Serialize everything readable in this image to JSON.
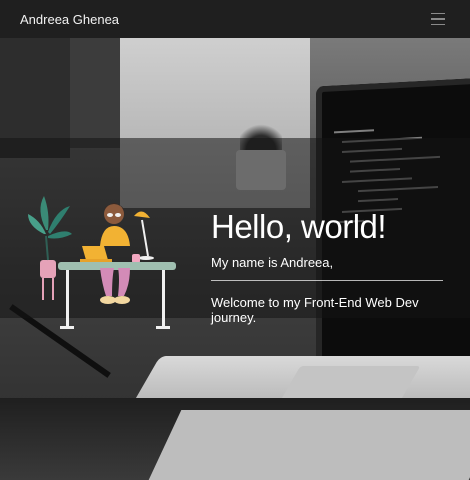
{
  "navbar": {
    "brand": "Andreea Ghenea",
    "menu_icon": "hamburger-menu-icon"
  },
  "hero": {
    "title": "Hello, world!",
    "subtitle": "My name is Andreea,",
    "welcome": "Welcome to my Front-End Web Dev journey."
  },
  "illustration": {
    "icon": "woman-at-desk-illustration",
    "colors": {
      "desk": "#9fbfb0",
      "shirt": "#f2b233",
      "pants": "#d38bb7",
      "laptop": "#f2b233",
      "plant": "#2f7f6f"
    }
  }
}
